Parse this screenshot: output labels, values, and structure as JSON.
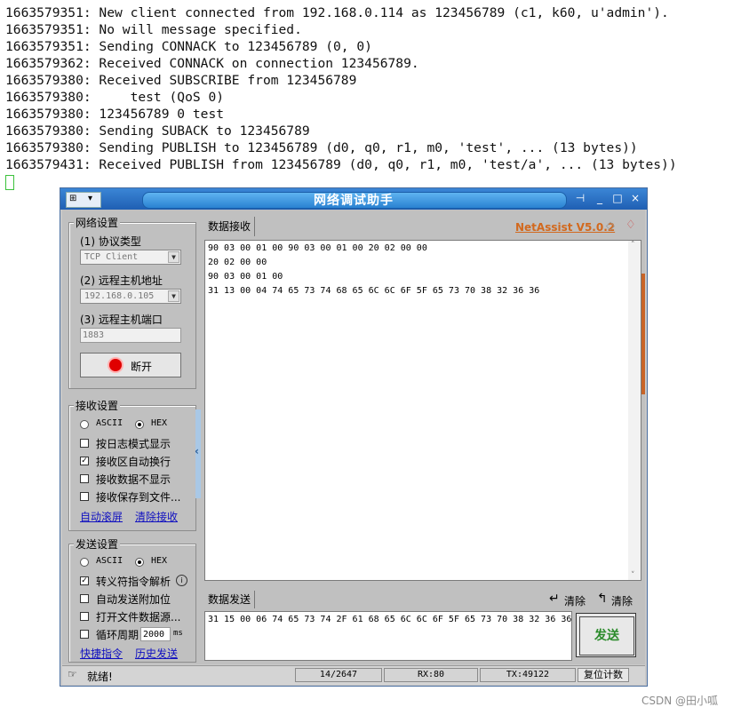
{
  "terminal": {
    "lines": [
      "1663579351: New client connected from 192.168.0.114 as 123456789 (c1, k60, u'admin').",
      "1663579351: No will message specified.",
      "1663579351: Sending CONNACK to 123456789 (0, 0)",
      "1663579362: Received CONNACK on connection 123456789.",
      "1663579380: Received SUBSCRIBE from 123456789",
      "1663579380:     test (QoS 0)",
      "1663579380: 123456789 0 test",
      "1663579380: Sending SUBACK to 123456789",
      "1663579380: Sending PUBLISH to 123456789 (d0, q0, r1, m0, 'test', ... (13 bytes))",
      "1663579431: Received PUBLISH from 123456789 (d0, q0, r1, m0, 'test/a', ... (13 bytes))"
    ]
  },
  "window": {
    "title": "网络调试助手",
    "brand": "NetAssist V5.0.2",
    "min_glyph": "_",
    "max_glyph": "□",
    "close_glyph": "×",
    "pin_glyph": "⊣"
  },
  "network": {
    "group_title": "网络设置",
    "protocol_label": "(1) 协议类型",
    "protocol_value": "TCP Client",
    "host_label": "(2) 远程主机地址",
    "host_value": "192.168.0.105",
    "port_label": "(3) 远程主机端口",
    "port_value": "1883",
    "disconnect_label": "断开"
  },
  "receive_settings": {
    "group_title": "接收设置",
    "ascii_label": "ASCII",
    "hex_label": "HEX",
    "hex_selected": true,
    "options": [
      {
        "label": "按日志模式显示",
        "checked": false
      },
      {
        "label": "接收区自动换行",
        "checked": true
      },
      {
        "label": "接收数据不显示",
        "checked": false
      },
      {
        "label": "接收保存到文件...",
        "checked": false
      }
    ],
    "auto_scroll": "自动滚屏",
    "clear_receive": "清除接收"
  },
  "send_settings": {
    "group_title": "发送设置",
    "ascii_label": "ASCII",
    "hex_label": "HEX",
    "hex_selected": true,
    "options": [
      {
        "label": "转义符指令解析",
        "checked": true
      },
      {
        "label": "自动发送附加位",
        "checked": false
      },
      {
        "label": "打开文件数据源...",
        "checked": false
      },
      {
        "label": "循环周期",
        "checked": false
      }
    ],
    "cycle_value": "2000",
    "cycle_unit": "ms",
    "quick_commands": "快捷指令",
    "history": "历史发送"
  },
  "receive_area": {
    "tab_label": "数据接收",
    "lines": [
      "90 03 00 01 00 90 03 00 01 00 20 02 00 00",
      "20 02 00 00",
      "90 03 00 01 00",
      "31 13 00 04 74 65 73 74 68 65 6C 6C 6F 5F 65 73 70 38 32 36 36"
    ]
  },
  "send_area": {
    "tab_label": "数据发送",
    "clear1": "清除",
    "clear2": "清除",
    "content": "31 15 00 06 74 65 73 74 2F 61 68 65 6C 6C 6F 5F 65 73 70 38 32 36 36",
    "send_button": "发送"
  },
  "status": {
    "ready": "就绪!",
    "count": "14/2647",
    "rx": "RX:80",
    "tx": "TX:49122",
    "reset": "复位计数"
  },
  "watermark": "CSDN @田小呱"
}
